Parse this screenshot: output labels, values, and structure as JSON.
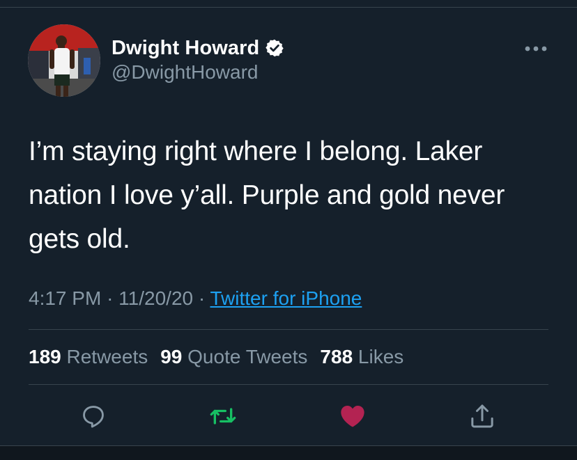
{
  "tweet": {
    "author": {
      "display_name": "Dwight Howard",
      "handle": "@DwightHoward",
      "verified": true
    },
    "text_lines": [
      "I’m staying right where I belong. Laker",
      "nation I love y’all. Purple and gold never",
      "gets old."
    ],
    "time": "4:17 PM",
    "date": "11/20/20",
    "separator": "·",
    "source": "Twitter for iPhone",
    "stats": {
      "retweets_count": "189",
      "retweets_label": "Retweets",
      "quote_tweets_count": "99",
      "quote_tweets_label": "Quote Tweets",
      "likes_count": "788",
      "likes_label": "Likes"
    },
    "actions": [
      {
        "name": "reply",
        "icon": "reply-icon"
      },
      {
        "name": "retweet",
        "icon": "retweet-icon",
        "active": true
      },
      {
        "name": "like",
        "icon": "heart-icon",
        "active": true
      },
      {
        "name": "share",
        "icon": "share-icon"
      }
    ]
  },
  "colors": {
    "background": "#15202b",
    "text_primary": "#ffffff",
    "text_secondary": "#8899a6",
    "link": "#1da1f2",
    "divider": "#38444d",
    "retweet_active": "#17bf63",
    "like_active": "#e0245e",
    "verified_badge": "#ffffff"
  }
}
